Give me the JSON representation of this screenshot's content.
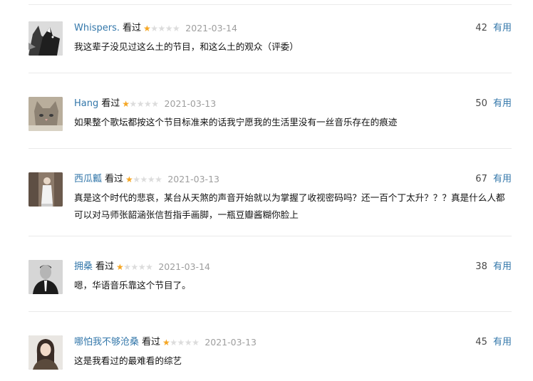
{
  "status_label": "看过",
  "useful_label": "有用",
  "comments": [
    {
      "username": "Whispers.",
      "rating": 1,
      "date": "2021-03-14",
      "votes": "42",
      "text": "我这辈子没见过这么土的节目，和这么土的观众（评委）"
    },
    {
      "username": "Hang",
      "rating": 1,
      "date": "2021-03-13",
      "votes": "50",
      "text": "如果整个歌坛都按这个节目标准来的话我宁愿我的生活里没有一丝音乐存在的痕迹"
    },
    {
      "username": "西瓜瓤",
      "rating": 1,
      "date": "2021-03-13",
      "votes": "67",
      "text": "真是这个时代的悲哀，某台从天煞的声音开始就以为掌握了收视密码吗？还一百个丁太升？？？真是什么人都可以对马师张韶涵张信哲指手画脚，一瓶豆瓣酱糊你脸上"
    },
    {
      "username": "拥桑",
      "rating": 1,
      "date": "2021-03-14",
      "votes": "38",
      "text": "嗯，华语音乐靠这个节目了。"
    },
    {
      "username": "哪怕我不够沧桑",
      "rating": 1,
      "date": "2021-03-13",
      "votes": "45",
      "text": "这是我看过的最难看的综艺"
    }
  ]
}
